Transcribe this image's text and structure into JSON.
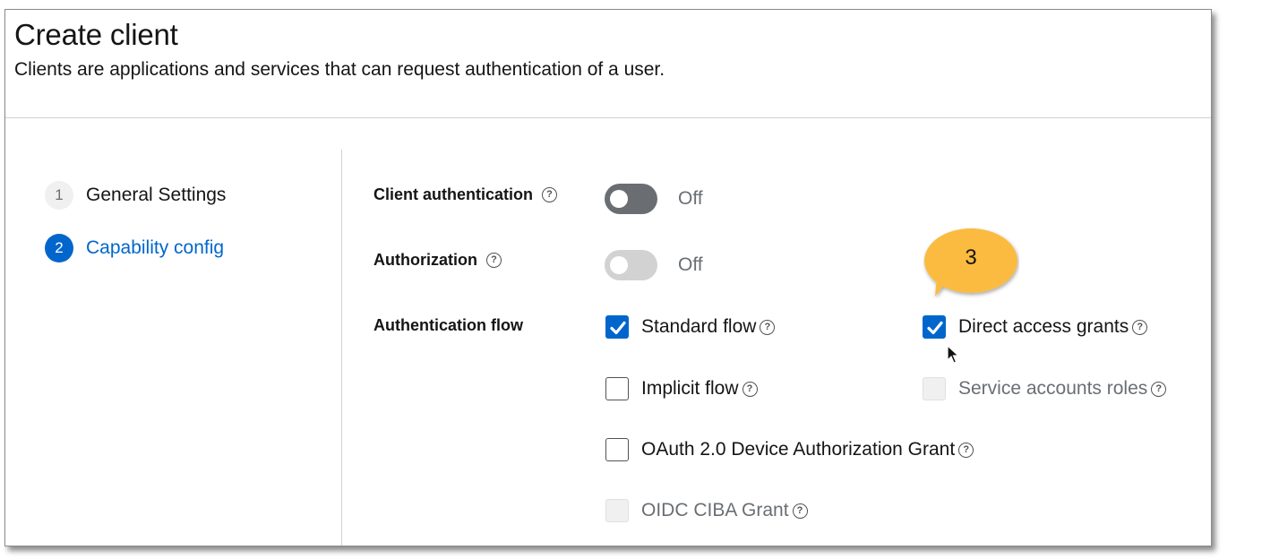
{
  "header": {
    "title": "Create client",
    "description": "Clients are applications and services that can request authentication of a user."
  },
  "wizard": {
    "steps": [
      {
        "number": "1",
        "label": "General Settings",
        "current": false
      },
      {
        "number": "2",
        "label": "Capability config",
        "current": true
      }
    ]
  },
  "form": {
    "client_authentication": {
      "label": "Client authentication",
      "help_icon": "help-icon",
      "value": false,
      "state_text": "Off",
      "disabled": false
    },
    "authorization": {
      "label": "Authorization",
      "help_icon": "help-icon",
      "value": false,
      "state_text": "Off",
      "disabled": true
    },
    "authentication_flow": {
      "label": "Authentication flow",
      "options": [
        {
          "label": "Standard flow",
          "checked": true,
          "disabled": false
        },
        {
          "label": "Direct access grants",
          "checked": true,
          "disabled": false
        },
        {
          "label": "Implicit flow",
          "checked": false,
          "disabled": false
        },
        {
          "label": "Service accounts roles",
          "checked": false,
          "disabled": true
        },
        {
          "label": "OAuth 2.0 Device Authorization Grant",
          "checked": false,
          "disabled": false
        },
        {
          "label": "OIDC CIBA Grant",
          "checked": false,
          "disabled": true
        }
      ]
    }
  },
  "annotation": {
    "callout_number": "3",
    "color": "#fbbb3f"
  },
  "colors": {
    "primary": "#0066cc",
    "toggle_off": "#6a6e73",
    "toggle_disabled": "#d2d2d2",
    "text_secondary": "#6a6e73"
  }
}
